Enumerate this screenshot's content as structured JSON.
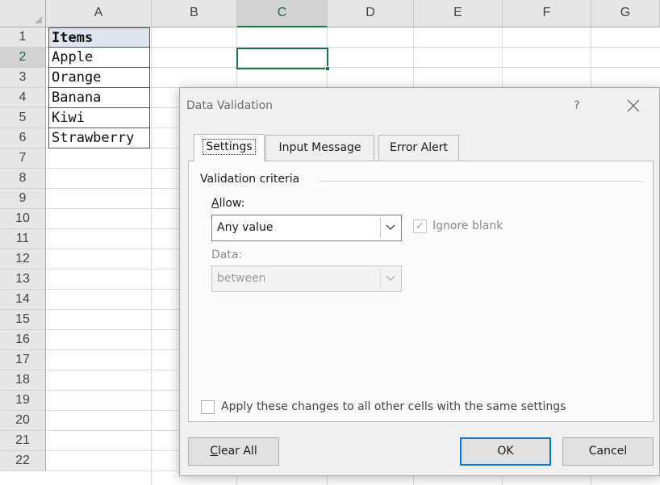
{
  "spreadsheet": {
    "columns": [
      "A",
      "B",
      "C",
      "D",
      "E",
      "F",
      "G"
    ],
    "selected_column": "C",
    "rows": [
      "1",
      "2",
      "3",
      "4",
      "5",
      "6",
      "7",
      "8",
      "9",
      "10",
      "11",
      "12",
      "13",
      "14",
      "15",
      "16",
      "17",
      "18",
      "19",
      "20",
      "21",
      "22"
    ],
    "selected_row": "2",
    "column_a": [
      "Items",
      "Apple",
      "Orange",
      "Banana",
      "Kiwi",
      "Strawberry"
    ],
    "active_cell": "C2",
    "colors": {
      "selection": "#217346",
      "header_fill": "#dde6f0"
    }
  },
  "dialog": {
    "title": "Data Validation",
    "help_label": "?",
    "close_icon": "close-icon",
    "tabs": [
      {
        "label": "Settings",
        "active": true
      },
      {
        "label": "Input Message",
        "active": false
      },
      {
        "label": "Error Alert",
        "active": false
      }
    ],
    "criteria_title": "Validation criteria",
    "allow": {
      "label_accel": "A",
      "label_rest": "llow:",
      "value": "Any value"
    },
    "ignore_blank": {
      "label": "Ignore blank",
      "checked": true,
      "disabled": true
    },
    "data": {
      "label": "Data:",
      "value": "between",
      "disabled": true
    },
    "apply_all": {
      "label": "Apply these changes to all other cells with the same settings",
      "checked": false
    },
    "buttons": {
      "clear_all_accel": "C",
      "clear_all_rest": "lear All",
      "ok": "OK",
      "cancel": "Cancel"
    }
  }
}
